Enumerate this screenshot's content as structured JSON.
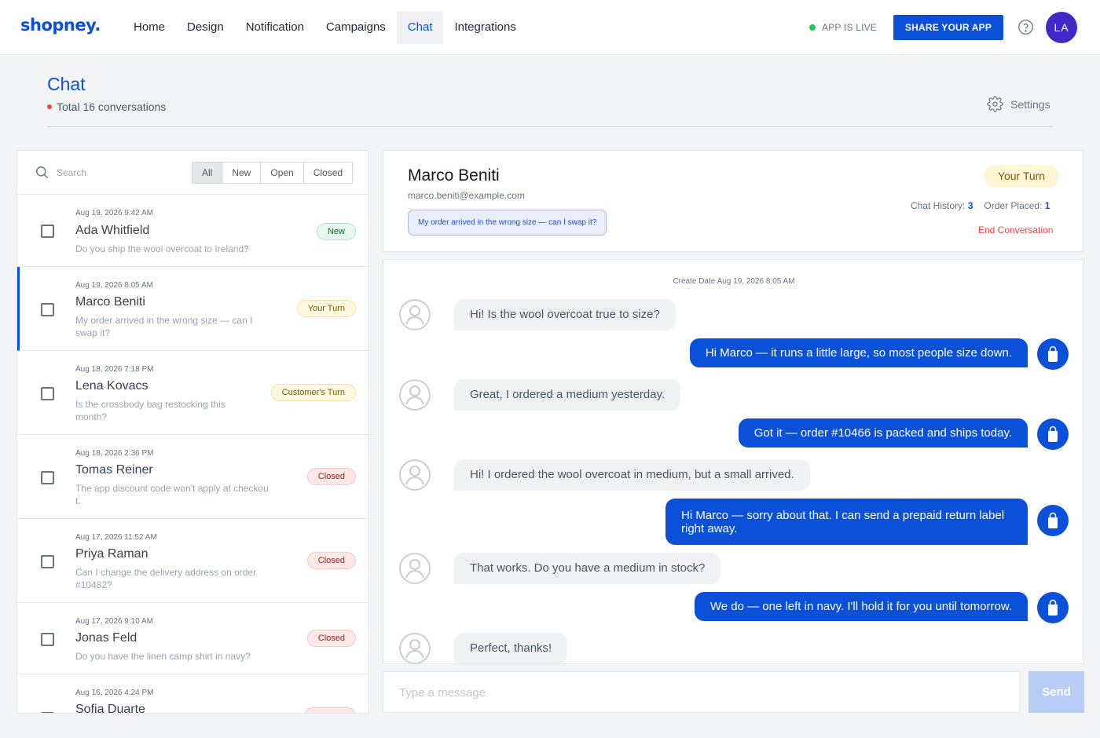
{
  "brand": {
    "logo_text": "shopney."
  },
  "nav": {
    "items": [
      "Home",
      "Design",
      "Notification",
      "Campaigns",
      "Chat",
      "Integrations"
    ],
    "active": "Chat"
  },
  "topbar": {
    "status_label": "APP IS LIVE",
    "share_label": "SHARE YOUR APP",
    "avatar_initials": "LA",
    "status_color": "#22c55e",
    "accent_color": "#0b50d9"
  },
  "page": {
    "title": "Chat",
    "subtitle": "Total 16 conversations",
    "settings_label": "Settings"
  },
  "list": {
    "search_placeholder": "Search",
    "filters": [
      "All",
      "New",
      "Open",
      "Closed"
    ],
    "active_filter": "All",
    "conversations": [
      {
        "date": "Aug 19, 2026 9:42 AM",
        "name": "Ada Whitfield",
        "preview": "Do you ship the wool overcoat to Ireland?",
        "badge": "New",
        "badge_type": "new",
        "selected": false
      },
      {
        "date": "Aug 19, 2026 8:05 AM",
        "name": "Marco Beniti",
        "preview": "My order arrived in the wrong size — can I swap it?",
        "badge": "Your Turn",
        "badge_type": "your",
        "selected": true
      },
      {
        "date": "Aug 18, 2026 7:18 PM",
        "name": "Lena Kovacs",
        "preview": "Is the crossbody bag restocking this month?",
        "badge": "Customer's Turn",
        "badge_type": "your",
        "selected": false
      },
      {
        "date": "Aug 18, 2026 2:36 PM",
        "name": "Tomas Reiner",
        "preview": "The app discount code won't apply at checkout.",
        "badge": "Closed",
        "badge_type": "closed",
        "selected": false
      },
      {
        "date": "Aug 17, 2026 11:52 AM",
        "name": "Priya Raman",
        "preview": "Can I change the delivery address on order #10482?",
        "badge": "Closed",
        "badge_type": "closed",
        "selected": false
      },
      {
        "date": "Aug 17, 2026 9:10 AM",
        "name": "Jonas Feld",
        "preview": "Do you have the linen camp shirt in navy?",
        "badge": "Closed",
        "badge_type": "closed",
        "selected": false
      },
      {
        "date": "Aug 16, 2026 4:24 PM",
        "name": "Sofia Duarte",
        "preview": "",
        "badge": "",
        "badge_type": "closed",
        "selected": false
      }
    ]
  },
  "conversation": {
    "customer_name": "Marco Beniti",
    "customer_email": "marco.beniti@example.com",
    "subject": "My order arrived in the wrong size — can I swap it?",
    "turn_label": "Your Turn",
    "chat_history_label": "Chat History:",
    "chat_history_count": "3",
    "order_placed_label": "Order Placed:",
    "order_placed_count": "1",
    "end_label": "End Conversation",
    "create_date": "Create Date Aug 19, 2026 8:05 AM",
    "messages": [
      {
        "from": "customer",
        "text": "Hi! Is the wool overcoat true to size?"
      },
      {
        "from": "store",
        "text": "Hi Marco — it runs a little large, so most people size down."
      },
      {
        "from": "customer",
        "text": "Great, I ordered a medium yesterday."
      },
      {
        "from": "store",
        "text": "Got it — order #10466 is packed and ships today."
      },
      {
        "from": "customer",
        "text": "Hi! I ordered the wool overcoat in medium, but a small arrived."
      },
      {
        "from": "store",
        "text": "Hi Marco — sorry about that. I can send a prepaid return label right away."
      },
      {
        "from": "customer",
        "text": "That works. Do you have a medium in stock?"
      },
      {
        "from": "store",
        "text": "We do — one left in navy. I'll hold it for you until tomorrow."
      },
      {
        "from": "customer",
        "text": "Perfect, thanks!"
      }
    ]
  },
  "composer": {
    "placeholder": "Type a message",
    "send_label": "Send"
  }
}
